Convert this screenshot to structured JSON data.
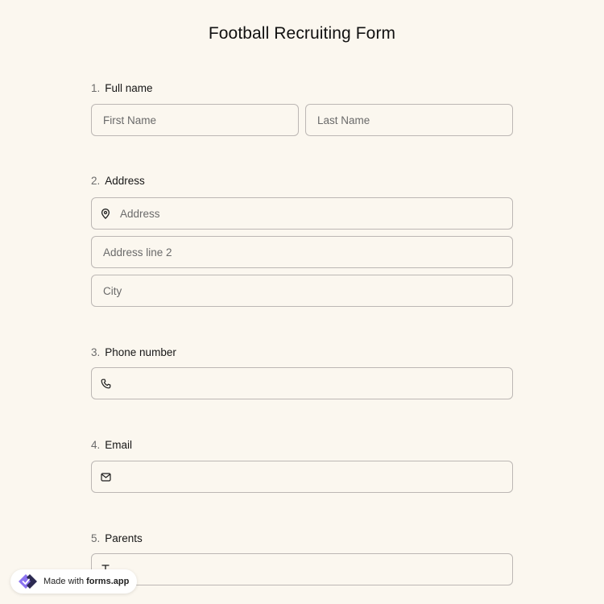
{
  "title": "Football Recruiting Form",
  "questions": [
    {
      "number": "1.",
      "label": "Full name",
      "fields": {
        "first": "First Name",
        "last": "Last Name"
      }
    },
    {
      "number": "2.",
      "label": "Address",
      "fields": {
        "address": "Address",
        "line2": "Address line 2",
        "city": "City"
      }
    },
    {
      "number": "3.",
      "label": "Phone number"
    },
    {
      "number": "4.",
      "label": "Email"
    },
    {
      "number": "5.",
      "label": "Parents"
    }
  ],
  "badge": {
    "prefix": "Made with",
    "brand": "forms.app"
  },
  "icons": {
    "address": "map-pin-icon",
    "phone": "phone-icon",
    "email": "envelope-icon",
    "parents": "text-t-icon",
    "badge_logo": "forms-app-logo-icon"
  },
  "colors": {
    "background": "#fbf7ef",
    "border": "#bcb7b4",
    "logo_dark": "#2c2a52",
    "logo_purple": "#8b73f0"
  }
}
